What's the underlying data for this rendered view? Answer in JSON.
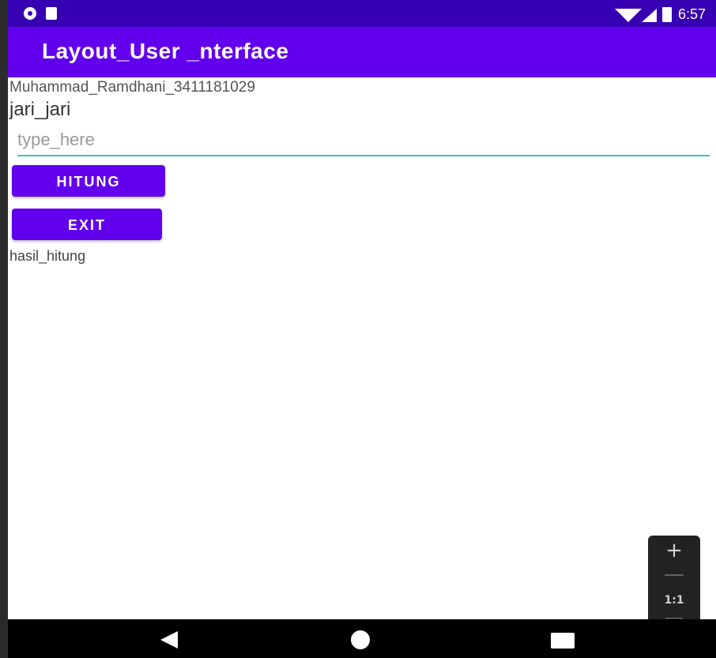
{
  "status_bar": {
    "time": "6:57",
    "icons": [
      "record-icon",
      "sd-card-icon",
      "wifi-icon",
      "cell-signal-icon",
      "battery-icon"
    ]
  },
  "app_bar": {
    "title": "Layout_User _nterface"
  },
  "content": {
    "name_text": "Muhammad_Ramdhani_3411181029",
    "radius_label": "jari_jari",
    "radius_input": {
      "value": "",
      "placeholder": "type_here"
    },
    "hitung_button": "HITUNG",
    "exit_button": "EXIT",
    "result_text": "hasil_hitung"
  },
  "zoom_controls": {
    "zoom_in": "+",
    "zoom_out": "—",
    "actual_size": "1:1"
  },
  "nav_bar": {
    "icons": [
      "back-icon",
      "home-icon",
      "recents-icon"
    ]
  },
  "colors": {
    "status_bar": "#3700b3",
    "app_bar": "#6200ee",
    "button": "#6200ee",
    "input_underline": "#2ec4c9"
  }
}
